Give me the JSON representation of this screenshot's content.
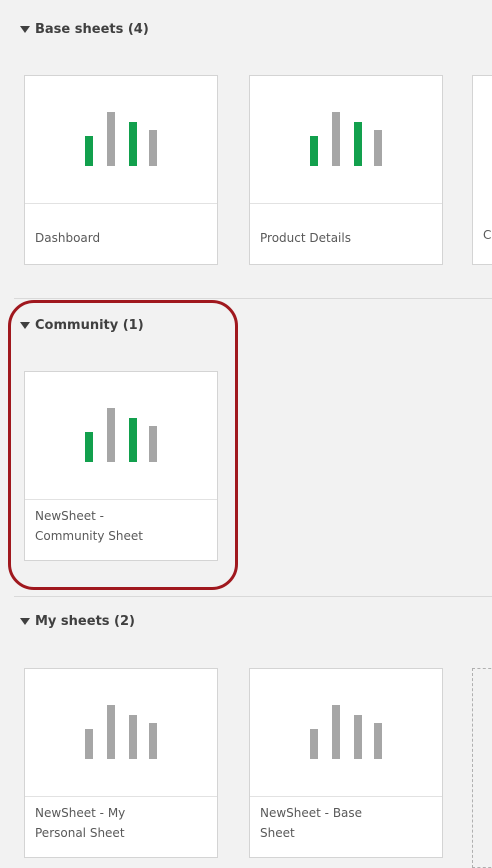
{
  "sections": {
    "base": {
      "header": "Base sheets (4)",
      "cards": [
        {
          "title": "Dashboard"
        },
        {
          "title": "Product Details"
        }
      ],
      "partial_card_title": "C"
    },
    "community": {
      "header": "Community (1)",
      "cards": [
        {
          "title_line1": "NewSheet -",
          "title_line2": "Community Sheet"
        }
      ]
    },
    "my": {
      "header": "My sheets (2)",
      "cards": [
        {
          "title_line1": "NewSheet - My",
          "title_line2": "Personal Sheet"
        },
        {
          "title_line1": "NewSheet - Base",
          "title_line2": "Sheet"
        }
      ]
    }
  },
  "icons": {
    "collapse": "caret-down-icon",
    "sheet_thumbnail": "bar-chart-icon"
  },
  "colors": {
    "published_bar": "#12a04d",
    "neutral_bar": "#a6a6a6",
    "highlight": "#a0181e"
  }
}
